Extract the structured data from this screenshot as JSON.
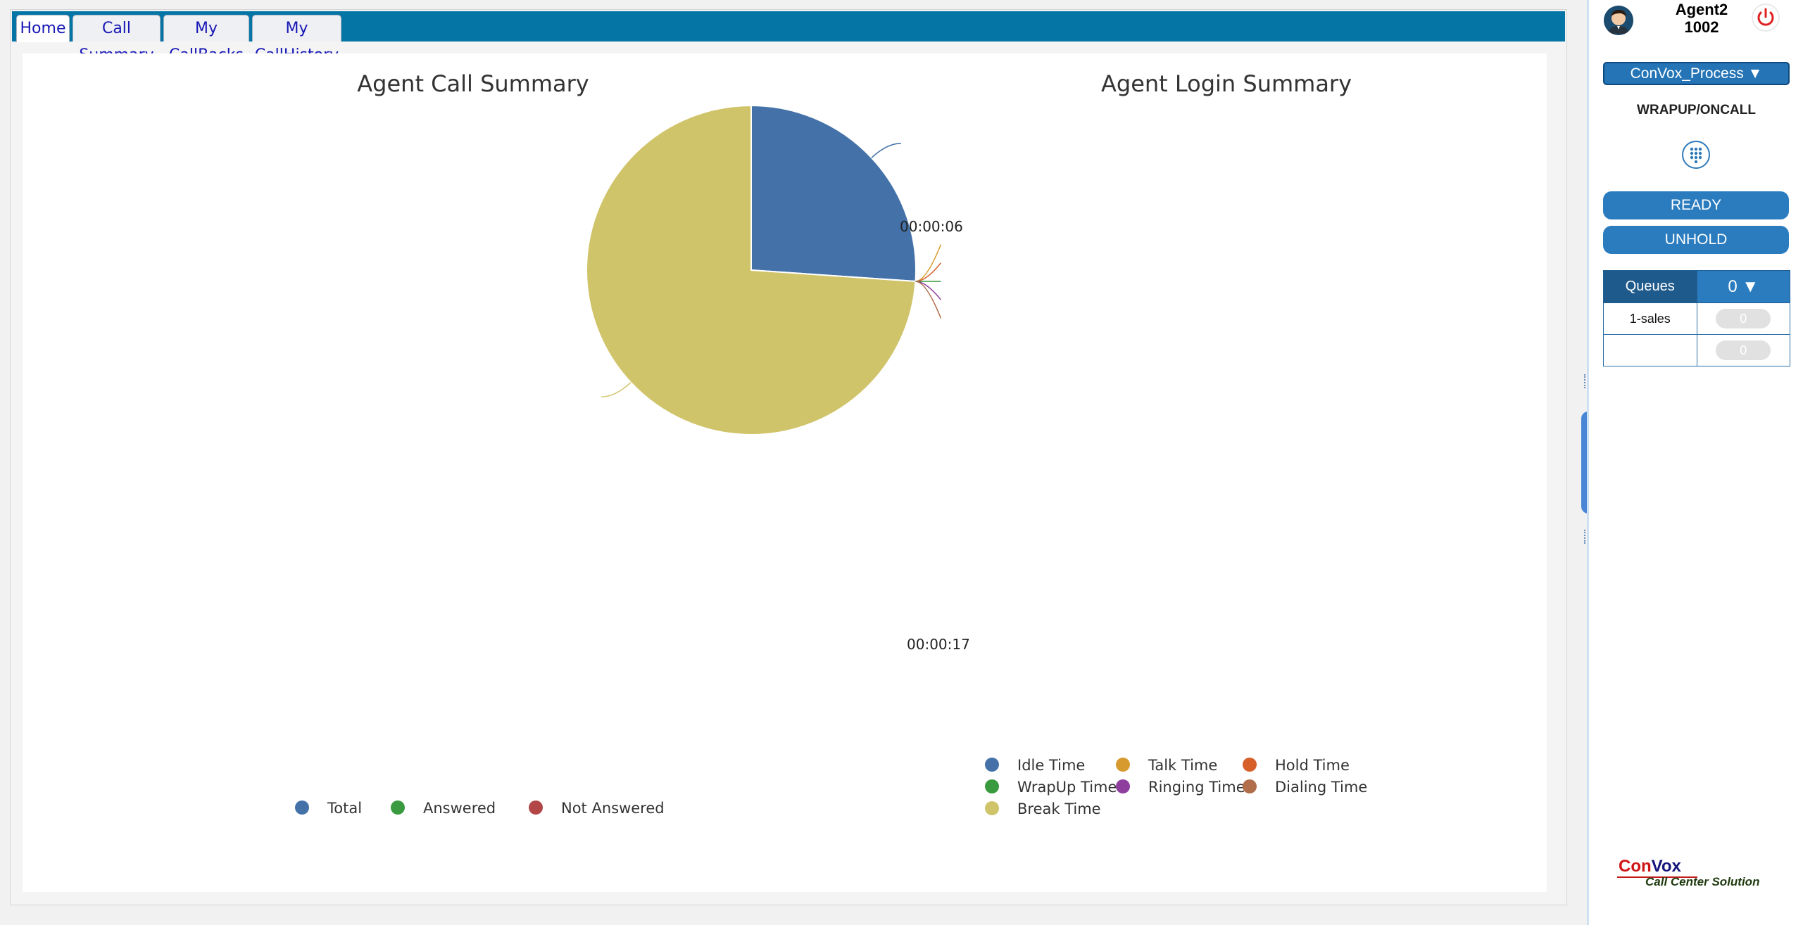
{
  "tabs": [
    {
      "label": "Home",
      "active": true
    },
    {
      "label": "Call Summary",
      "active": false
    },
    {
      "label": "My CallBacks",
      "active": false
    },
    {
      "label": "My CallHistory",
      "active": false
    }
  ],
  "call_summary": {
    "title": "Agent Call Summary",
    "legend": [
      {
        "label": "Total",
        "color": "#4472a8"
      },
      {
        "label": "Answered",
        "color": "#3a9a3f"
      },
      {
        "label": "Not Answered",
        "color": "#b34646"
      }
    ]
  },
  "login_summary": {
    "title": "Agent Login Summary",
    "slice_labels": {
      "idle": "00:00:06",
      "break": "00:00:17"
    }
  },
  "chart_data": [
    {
      "type": "pie",
      "title": "Agent Login Summary",
      "series": [
        {
          "name": "Idle Time",
          "value": 6,
          "display": "00:00:06",
          "color": "#4472a8"
        },
        {
          "name": "Talk Time",
          "value": 0,
          "color": "#d79a2e"
        },
        {
          "name": "Hold Time",
          "value": 0,
          "color": "#d65f2a"
        },
        {
          "name": "WrapUp Time",
          "value": 0,
          "color": "#3a9a3f"
        },
        {
          "name": "Ringing Time",
          "value": 0,
          "color": "#8e3f9e"
        },
        {
          "name": "Dialing Time",
          "value": 0,
          "color": "#b06e4a"
        },
        {
          "name": "Break Time",
          "value": 17,
          "display": "00:00:17",
          "color": "#d0c46a"
        }
      ],
      "legend_position": "bottom"
    }
  ],
  "agent": {
    "name": "Agent2",
    "ext": "1002"
  },
  "process": {
    "label": "ConVox_Process ▼"
  },
  "status": "WRAPUP/ONCALL",
  "buttons": {
    "ready": "READY",
    "unhold": "UNHOLD"
  },
  "queues": {
    "header": "Queues",
    "count": "0 ▼",
    "rows": [
      {
        "name": "1-sales",
        "value": "0"
      },
      {
        "name": "",
        "value": "0"
      }
    ]
  },
  "logo": {
    "con": "Con",
    "vox": "Vox",
    "tagline": "Call Center Solution"
  },
  "colors": {
    "tabbar": "#0575a6",
    "button": "#2a7cbf",
    "queue_header": "#1f5a8c"
  }
}
